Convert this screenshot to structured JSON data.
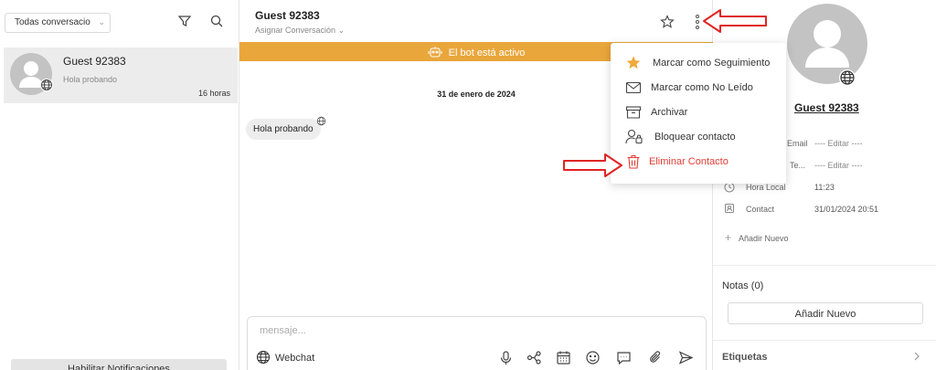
{
  "sidebar": {
    "filter_value": "Todas conversacio",
    "conversation": {
      "name": "Guest 92383",
      "preview": "Hola probando",
      "time": "16 horas"
    },
    "notifications_label": "Habilitar Notificaciones"
  },
  "chat": {
    "title": "Guest 92383",
    "assign_label": "Asignar Conversación",
    "bot_banner": "El bot está activo",
    "date_label": "31 de enero de 2024",
    "message": "Hola probando",
    "composer_placeholder": "mensaje...",
    "channel": "Webchat"
  },
  "menu": {
    "items": [
      {
        "label": "Marcar como Seguimiento",
        "icon": "star-filled-icon"
      },
      {
        "label": "Marcar como No Leído",
        "icon": "envelope-icon"
      },
      {
        "label": "Archivar",
        "icon": "archive-icon"
      },
      {
        "label": "Bloquear contacto",
        "icon": "user-lock-icon"
      },
      {
        "label": "Eliminar Contacto",
        "icon": "trash-icon"
      }
    ]
  },
  "contact": {
    "name": "Guest 92383",
    "fields": [
      {
        "label": "Email",
        "value": "---- Editar ----"
      },
      {
        "label": "Te...",
        "value": "---- Editar ----"
      },
      {
        "label": "Hora Local",
        "value": "11:23"
      },
      {
        "label": "Contact",
        "value": "31/01/2024 20:51"
      }
    ],
    "add_new_label": "Añadir Nuevo",
    "notes_title": "Notas (0)",
    "notes_add_button": "Añadir Nuevo",
    "tags_title": "Etiquetas"
  },
  "colors": {
    "banner": "#e9a63b",
    "danger": "#e23d33",
    "star": "#f0a93b",
    "annotation_arrow": "#e02424"
  }
}
